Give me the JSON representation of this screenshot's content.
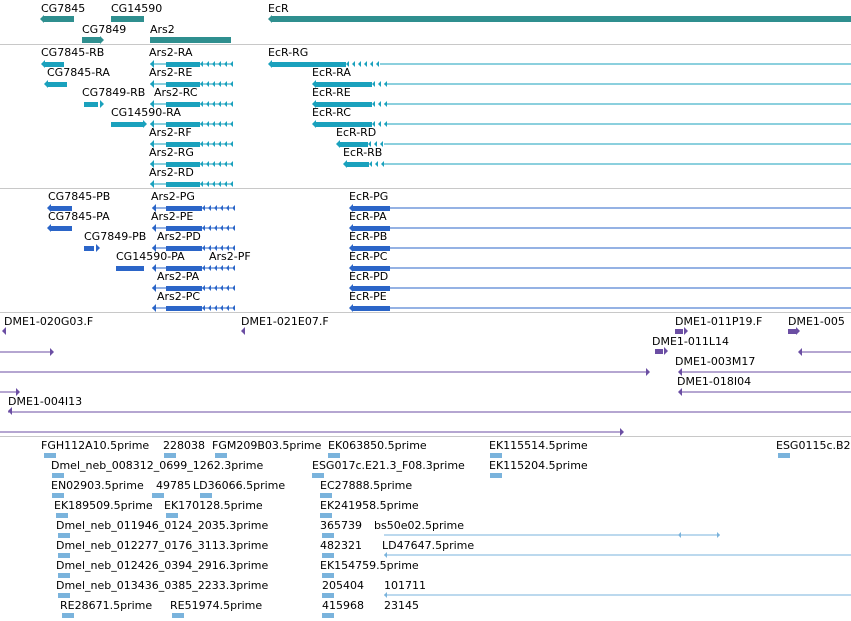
{
  "colors": {
    "gene": "#2f8f8f",
    "transcript": "#1aa1bd",
    "protein": "#2b65c8",
    "clone": "#6b4ea3",
    "est": "#7ab3dc",
    "divider": "#c8c8c8"
  },
  "tracks": {
    "genes": {
      "labels": [
        "CG7845",
        "CG14590",
        "EcR",
        "CG7849",
        "Ars2"
      ]
    },
    "transcripts": {
      "labels": [
        "CG7845-RB",
        "Ars2-RA",
        "EcR-RG",
        "CG7845-RA",
        "Ars2-RE",
        "EcR-RA",
        "CG7849-RB",
        "Ars2-RC",
        "EcR-RE",
        "CG14590-RA",
        "EcR-RC",
        "Ars2-RF",
        "EcR-RD",
        "Ars2-RG",
        "EcR-RB",
        "Ars2-RD"
      ]
    },
    "proteins": {
      "labels": [
        "CG7845-PB",
        "Ars2-PG",
        "EcR-PG",
        "CG7845-PA",
        "Ars2-PE",
        "EcR-PA",
        "CG7849-PB",
        "Ars2-PD",
        "EcR-PB",
        "CG14590-PA",
        "Ars2-PF",
        "EcR-PC",
        "Ars2-PA",
        "EcR-PD",
        "Ars2-PC",
        "EcR-PE"
      ]
    },
    "clones": {
      "labels": [
        "DME1-020G03.F",
        "DME1-021E07.F",
        "DME1-011P19.F",
        "DME1-005",
        "DME1-011L14",
        "DME1-003M17",
        "DME1-018I04",
        "DME1-004I13"
      ]
    },
    "ests": {
      "labels": [
        "FGH112A10.5prime",
        "228038",
        "FGM209B03.5prime",
        "EK063850.5prime",
        "EK115514.5prime",
        "ESG0115c.B2",
        "Dmel_neb_008312_0699_1262.3prime",
        "ESG017c.E21.3_F08.3prime",
        "EK115204.5prime",
        "EN02903.5prime",
        "49785",
        "LD36066.5prime",
        "EC27888.5prime",
        "EK189509.5prime",
        "EK170128.5prime",
        "EK241958.5prime",
        "Dmel_neb_011946_0124_2035.3prime",
        "365739",
        "bs50e02.5prime",
        "Dmel_neb_012277_0176_3113.3prime",
        "482321",
        "LD47647.5prime",
        "Dmel_neb_012426_0394_2916.3prime",
        "EK154759.5prime",
        "Dmel_neb_013436_0385_2233.3prime",
        "205404",
        "101711",
        "RE28671.5prime",
        "RE51974.5prime",
        "415968",
        "23145"
      ]
    }
  }
}
